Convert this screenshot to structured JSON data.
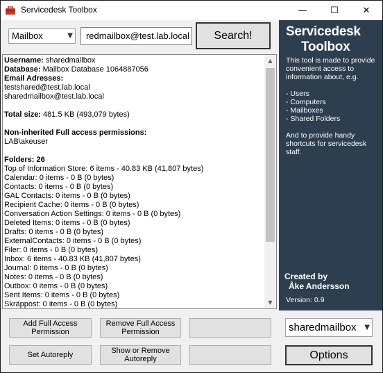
{
  "window": {
    "title": "Servicedesk Toolbox",
    "controls": {
      "minimize": "—",
      "maximize": "☐",
      "close": "✕"
    }
  },
  "search": {
    "type_selected": "Mailbox",
    "query": "redmailbox@test.lab.local",
    "button": "Search!"
  },
  "results": {
    "username_label": "Username:",
    "username_value": "sharedmailbox",
    "database_label": "Database:",
    "database_value": "Mailbox Database 1064887056",
    "email_label": "Email Adresses:",
    "emails": [
      "testshared@test.lab.local",
      "sharedmailbox@test.lab.local"
    ],
    "size_label": "Total size:",
    "size_value": "481.5 KB (493,079 bytes)",
    "perm_label": "Non-inherited Full access permissions:",
    "perm_value": "LAB\\akeuser",
    "folders_label": "Folders: 26",
    "folders": [
      "Top of Information Store: 6 items - 40.83 KB (41,807 bytes)",
      "Calendar: 0 items - 0 B (0 bytes)",
      "Contacts: 0 items - 0 B (0 bytes)",
      "GAL Contacts: 0 items - 0 B (0 bytes)",
      "Recipient Cache: 0 items - 0 B (0 bytes)",
      "Conversation Action Settings: 0 items - 0 B (0 bytes)",
      "Deleted Items: 0 items - 0 B (0 bytes)",
      "Drafts: 0 items - 0 B (0 bytes)",
      "ExternalContacts: 0 items - 0 B (0 bytes)",
      "Filer: 0 items - 0 B (0 bytes)",
      "Inbox: 6 items - 40.83 KB (41,807 bytes)",
      "Journal: 0 items - 0 B (0 bytes)",
      "Notes: 0 items - 0 B (0 bytes)",
      "Outbox: 0 items - 0 B (0 bytes)",
      "Sent Items: 0 items - 0 B (0 bytes)",
      "Skräppost: 0 items - 0 B (0 bytes)"
    ]
  },
  "side_panel": {
    "title_line1": "Servicedesk",
    "title_line2": "Toolbox",
    "intro": "This tool is made to provide convenient access to information about, e.g.",
    "items": [
      "- Users",
      "- Computers",
      "- Mailboxes",
      "- Shared Folders"
    ],
    "outro": "And to provide handy shortcuts for servicedesk staff.",
    "created_by": "Created by",
    "author": "Åke Andersson",
    "version": "Version: 0.9",
    "bg_color": "#2d3e4f"
  },
  "actions": {
    "add_full_access": "Add Full Access Permission",
    "remove_full_access": "Remove Full Access Permission",
    "set_autoreply": "Set Autoreply",
    "show_remove_autoreply": "Show or Remove Autoreply",
    "blank1": "",
    "blank2": "",
    "mailbox_selected": "sharedmailbox",
    "options": "Options"
  }
}
